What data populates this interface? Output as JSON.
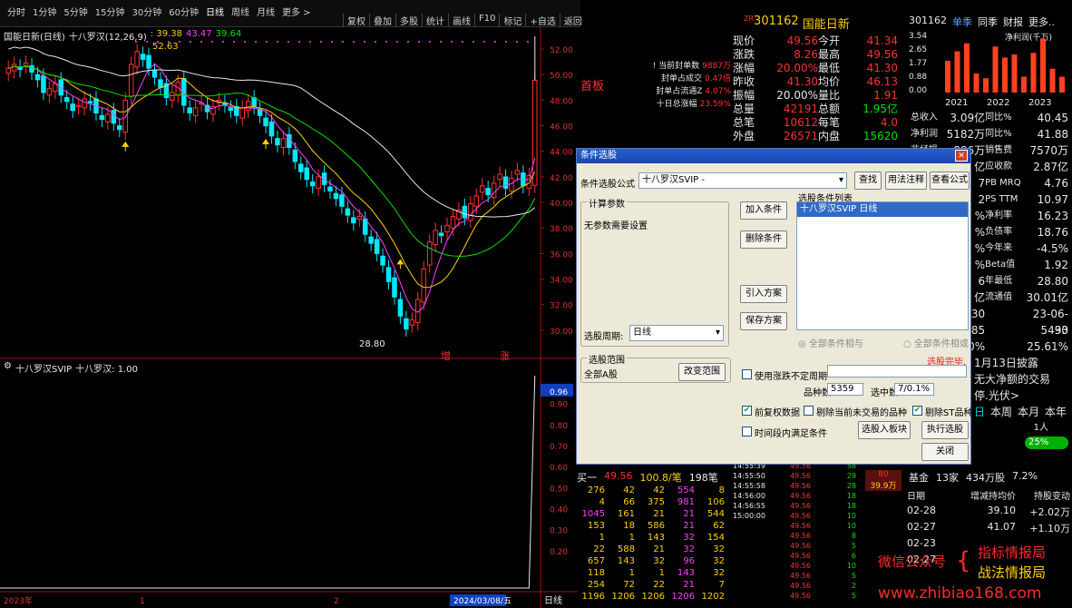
{
  "toolbar": {
    "items": [
      "分时",
      "1分钟",
      "5分钟",
      "15分钟",
      "30分钟",
      "60分钟",
      "日线",
      "周线",
      "月线",
      "更多 >"
    ],
    "right_items": [
      "复权",
      "叠加",
      "多股",
      "统计",
      "画线",
      "F10",
      "标记",
      "+自选",
      "返回"
    ]
  },
  "chart_title": "国能日新(日线)",
  "ma_label": "十八罗汉(12,26,9)",
  "ma_values": [
    {
      "text": ": 39.38",
      "color": "#ffd000"
    },
    {
      "text": "43.47",
      "color": "#ff40ff"
    },
    {
      "text": "39.64",
      "color": "#00e000"
    }
  ],
  "price_axis": [
    "52.00",
    "50.00",
    "48.00",
    "46.00",
    "44.00",
    "42.00",
    "40.00",
    "38.00",
    "36.00",
    "34.00",
    "32.00",
    "30.00"
  ],
  "hi_label": "52.63",
  "lo_label": "28.80",
  "zeng": "增",
  "zhang": "涨",
  "seal_info": [
    {
      "label": "! 当前封单数",
      "value": "9887万"
    },
    {
      "label": "封单占成交",
      "value": "0.47倍"
    },
    {
      "label": "封单占流通Z",
      "value": "4.07%"
    },
    {
      "label": "十日总涨幅",
      "value": "23.59%"
    }
  ],
  "shouban": "首板",
  "indicator_title": "十八罗汉SVIP",
  "indicator_value": "十八罗汉: 1.00",
  "ind_axis": [
    "0.96",
    "0.90",
    "0.80",
    "0.70",
    "0.60",
    "0.50",
    "0.40",
    "0.30",
    "0.20"
  ],
  "x_axis": [
    "2023年",
    "1",
    "2",
    "2024/03/08/五"
  ],
  "x_unit": "日线",
  "quote": {
    "code": "301162",
    "name": "国能日新",
    "prefix": "ZR",
    "rows": [
      {
        "l": "现价",
        "v1": "49.56",
        "l2": "今开",
        "v2": "41.34"
      },
      {
        "l": "涨跌",
        "v1": "8.26",
        "l2": "最高",
        "v2": "49.56"
      },
      {
        "l": "涨幅",
        "v1": "20.00%",
        "l2": "最低",
        "v2": "41.30"
      },
      {
        "l": "昨收",
        "v1": "41.30",
        "l2": "均价",
        "v2": "46.13"
      },
      {
        "l": "振幅",
        "v1": "20.00%",
        "l2": "量比",
        "v2": "1.91"
      },
      {
        "l": "总量",
        "v1": "42191",
        "l2": "总额",
        "v2": "1.95亿"
      },
      {
        "l": "总笔",
        "v1": "10612",
        "l2": "每笔",
        "v2": "4.0"
      },
      {
        "l": "外盘",
        "v1": "26571",
        "l2": "内盘",
        "v2": "15620"
      }
    ]
  },
  "right_panel": {
    "code": "301162",
    "tabs": [
      "单季",
      "同季",
      "财报",
      "更多.."
    ],
    "chart_title": "净利润(千万)",
    "years": [
      "2021",
      "2022",
      "2023"
    ],
    "y_ticks": [
      "3.54",
      "2.65",
      "1.77",
      "0.88",
      "0.00"
    ],
    "bar_values": [
      2.0,
      2.6,
      3.1,
      1.2,
      0.9,
      2.9,
      2.2,
      2.4,
      1.0,
      2.5,
      3.4,
      1.5,
      1.0
    ],
    "rows": [
      {
        "l": "总收入",
        "v1": "3.09亿",
        "v2": "同比%",
        "v3": "40.45"
      },
      {
        "l": "净利润",
        "v1": "5182万",
        "v2": "同比%",
        "v3": "41.88"
      },
      {
        "l": "非经损",
        "v1": "886万",
        "v2": "销售费",
        "v3": "7570万"
      },
      {
        "l": "",
        "v1": "亿",
        "v2": "应收款",
        "v3": "2.87亿"
      },
      {
        "l": "",
        "v1": "7",
        "v2": "PB MRQ",
        "v3": "4.76"
      },
      {
        "l": "",
        "v1": "2",
        "v2": "PS TTM",
        "v3": "10.97"
      },
      {
        "l": "",
        "v1": "%",
        "v2": "净利率",
        "v3": "16.23"
      },
      {
        "l": "",
        "v1": "%",
        "v2": "负债率",
        "v3": "18.76"
      },
      {
        "l": "",
        "v1": "%",
        "v2": "今年来",
        "v3": "-4.5%"
      },
      {
        "l": "",
        "v1": "%",
        "v2": "Beta值",
        "v3": "1.92"
      },
      {
        "l": "",
        "v1": "6",
        "v2": "年最低",
        "v3": "28.80"
      },
      {
        "l": "",
        "v1": "亿",
        "v2": "流通值",
        "v3": "30.01亿"
      },
      {
        "l": "",
        "v1": "09-30",
        "v2": "",
        "v3": "23-06-30"
      },
      {
        "l": "",
        "v1": "6185",
        "v2": "",
        "v3": "5493"
      },
      {
        "l": "",
        "v1": "2.60%",
        "v2": "",
        "v3": "25.61%"
      }
    ],
    "disclose": "1月13日披露",
    "disclose2": "无大净额的交易",
    "topic": "停.光伏>",
    "periods": [
      "日",
      "本周",
      "本月",
      "本年"
    ],
    "one_person": "1人",
    "percent": "25%"
  },
  "dialog": {
    "title": "条件选股",
    "formula_label": "条件选股公式",
    "formula_value": "十八罗汉SVIP -",
    "btn_find": "查找",
    "btn_usage": "用法注释",
    "btn_view": "查看公式",
    "calc_group": "计算参数",
    "calc_note": "无参数需要设置",
    "btn_add": "加入条件",
    "btn_del": "删除条件",
    "list_title": "选股条件列表",
    "list_item": "十八罗汉SVIP  日线",
    "btn_import": "引入方案",
    "btn_save": "保存方案",
    "radio_and": "全部条件相与",
    "radio_or": "全部条件相或",
    "period_label": "选股周期:",
    "period_value": "日线",
    "done": "选股完毕.",
    "range_group": "选股范围",
    "range_value": "全部A股",
    "btn_range": "改变范围",
    "chk_uncertain": "使用涨跌不定周期",
    "count_label": "品种数",
    "count_value": "5359",
    "hit_label": "选中数",
    "hit_value": "7/0.1%",
    "chk_fq": "前复权数据",
    "chk_notrade": "剔除当前未交易的品种",
    "chk_st": "剔除ST品种",
    "chk_range": "时间段内满足条件",
    "btn_block": "选股入板块",
    "btn_exec": "执行选股",
    "btn_close": "关闭"
  },
  "book": {
    "head": {
      "l": "买一",
      "p": "49.56",
      "v": "100.8/笔",
      "n": "198笔"
    },
    "rows": [
      [
        "276",
        "42",
        "42",
        "554",
        "8"
      ],
      [
        "4",
        "66",
        "375",
        "981",
        "106"
      ],
      [
        "1045",
        "161",
        "21",
        "21",
        "544"
      ],
      [
        "153",
        "18",
        "586",
        "21",
        "62"
      ],
      [
        "1",
        "1",
        "143",
        "32",
        "154"
      ],
      [
        "22",
        "588",
        "21",
        "32",
        "32"
      ],
      [
        "657",
        "143",
        "32",
        "96",
        "32"
      ],
      [
        "118",
        "1",
        "1",
        "143",
        "32"
      ],
      [
        "254",
        "72",
        "22",
        "21",
        "7"
      ],
      [
        "1196",
        "1206",
        "1206",
        "1206",
        "1202"
      ]
    ]
  },
  "trades": {
    "top": [
      [
        "14:55:39",
        "49.56",
        "58"
      ],
      [
        "14:55:50",
        "49.56",
        "29"
      ],
      [
        "14:55:58",
        "49.56",
        "28"
      ],
      [
        "14:56:00",
        "49.56",
        "18"
      ],
      [
        "14:56:55",
        "49.56",
        "18"
      ],
      [
        "15:00:00",
        "49.56",
        "10"
      ],
      [
        "",
        "49.56",
        "10"
      ],
      [
        "",
        "49.56",
        "8"
      ],
      [
        "",
        "49.56",
        "5"
      ],
      [
        "",
        "49.56",
        "6"
      ],
      [
        "",
        "49.56",
        "10"
      ],
      [
        "",
        "49.56",
        "5"
      ],
      [
        "",
        "49.56",
        "2"
      ],
      [
        "",
        "49.56",
        "5"
      ]
    ],
    "seal": "80",
    "seal2": "39.9万"
  },
  "holdings": {
    "fund_label": "基金",
    "fund_count": "13家",
    "fund_shares": "434万股",
    "fund_pct": "7.2%",
    "head": [
      "日期",
      "增减持均价",
      "持股变动"
    ],
    "rows": [
      [
        "02-28",
        "39.10",
        "+2.02万"
      ],
      [
        "02-27",
        "41.07",
        "+1.10万"
      ],
      [
        "02-23",
        "",
        ""
      ],
      [
        "02-27",
        "",
        ""
      ]
    ]
  },
  "watermark": {
    "l1": "微信公众号",
    "b1": "指标情报局",
    "b2": "战法情报局",
    "url": "www.zhibiao168.com"
  }
}
